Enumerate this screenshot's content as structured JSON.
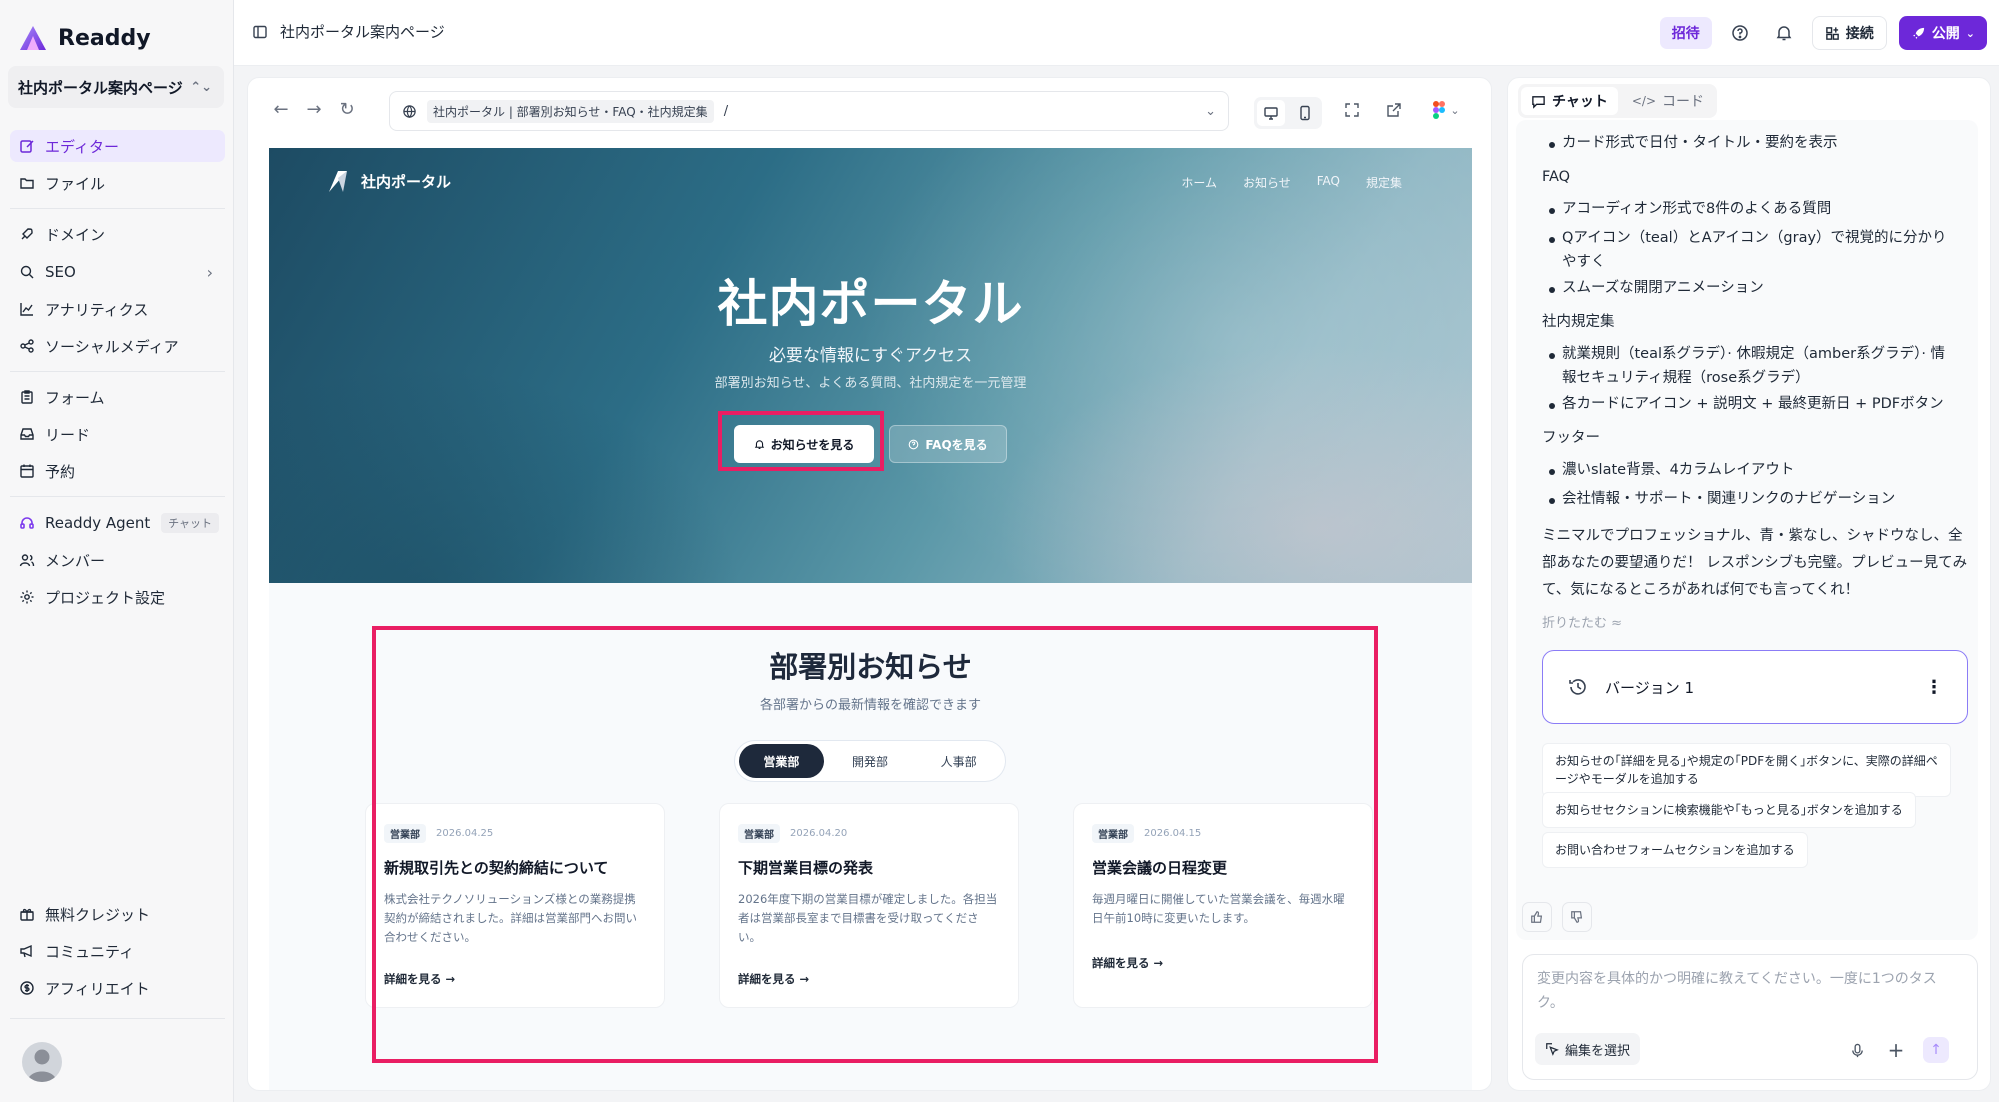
{
  "app": {
    "name": "Readdy",
    "project": "社内ポータル案内ページ"
  },
  "sidebar": {
    "items": [
      {
        "label": "エディター"
      },
      {
        "label": "ファイル"
      },
      {
        "label": "ドメイン"
      },
      {
        "label": "SEO"
      },
      {
        "label": "アナリティクス"
      },
      {
        "label": "ソーシャルメディア"
      },
      {
        "label": "フォーム"
      },
      {
        "label": "リード"
      },
      {
        "label": "予約"
      },
      {
        "label": "Readdy Agent",
        "chip": "チャット"
      },
      {
        "label": "メンバー"
      },
      {
        "label": "プロジェクト設定"
      },
      {
        "label": "無料クレジット"
      },
      {
        "label": "コミュニティ"
      },
      {
        "label": "アフィリエイト"
      }
    ]
  },
  "topbar": {
    "title": "社内ポータル案内ページ",
    "invite": "招待",
    "connect": "接続",
    "publish": "公開"
  },
  "browser": {
    "url_title": "社内ポータル | 部署別お知らせ・FAQ・社内規定集",
    "path": "/"
  },
  "site": {
    "logo": "社内ポータル",
    "nav": [
      "ホーム",
      "お知らせ",
      "FAQ",
      "規定集"
    ],
    "hero": {
      "title": "社内ポータル",
      "subtitle": "必要な情報にすぐアクセス",
      "desc": "部署別お知らせ、よくある質問、社内規定を一元管理",
      "btn_news": "お知らせを見る",
      "btn_faq": "FAQを見る"
    },
    "news": {
      "title": "部署別お知らせ",
      "subtitle": "各部署からの最新情報を確認できます",
      "tabs": [
        "営業部",
        "開発部",
        "人事部"
      ],
      "cards": [
        {
          "badge": "営業部",
          "date": "2026.04.25",
          "title": "新規取引先との契約締結について",
          "body": "株式会社テクノソリューションズ様との業務提携契約が締結されました。詳細は営業部門へお問い合わせください。",
          "link": "詳細を見る →"
        },
        {
          "badge": "営業部",
          "date": "2026.04.20",
          "title": "下期営業目標の発表",
          "body": "2026年度下期の営業目標が確定しました。各担当者は営業部長室まで目標書を受け取ってください。",
          "link": "詳細を見る →"
        },
        {
          "badge": "営業部",
          "date": "2026.04.15",
          "title": "営業会議の日程変更",
          "body": "毎週月曜日に開催していた営業会議を、毎週水曜日午前10時に変更いたします。",
          "link": "詳細を見る →"
        }
      ]
    }
  },
  "chat": {
    "tabs": [
      "チャット",
      "コード"
    ],
    "lines": {
      "b0": "カード形式で日付・タイトル・要約を表示",
      "h1": "FAQ",
      "b1": "アコーディオン形式で8件のよくある質問",
      "b2a": "Qアイコン（teal）とAアイコン（gray）で視覚的に分かり",
      "b2b": "やすく",
      "b3": "スムーズな開閉アニメーション",
      "h2": "社内規定集",
      "b4a": "就業規則（teal系グラデ）· 休暇規定（amber系グラデ）· 情",
      "b4b": "報セキュリティ規程（rose系グラデ）",
      "b5": "各カードにアイコン + 説明文 + 最終更新日 + PDFボタン",
      "h3": "フッター",
      "b6": "濃いslate背景、4カラムレイアウト",
      "b7": "会社情報・サポート・関連リンクのナビゲーション",
      "p1": "ミニマルでプロフェッショナル、青・紫なし、シャドウなし、全",
      "p2": "部あなたの要望通りだ！ レスポンシブも完璧。プレビュー見てみ",
      "p3": "て、気になるところがあれば何でも言ってくれ！"
    },
    "fold": "折りたたむ ≈",
    "version": "バージョン 1",
    "suggestions": {
      "s1a": "お知らせの｢詳細を見る｣や規定の｢PDFを開く｣ボタンに、実際の詳細ペ",
      "s1b": "ージやモーダルを追加する",
      "s2": "お知らせセクションに検索機能や｢もっと見る｣ボタンを追加する",
      "s3": "お問い合わせフォームセクションを追加する"
    },
    "composer_placeholder": "変更内容を具体的かつ明確に教えてください。一度に1つのタスク。",
    "select_edit": "編集を選択"
  },
  "colors": {
    "brand": "#6d28d9",
    "highlight": "#e91e63",
    "dark": "#1e293b"
  }
}
